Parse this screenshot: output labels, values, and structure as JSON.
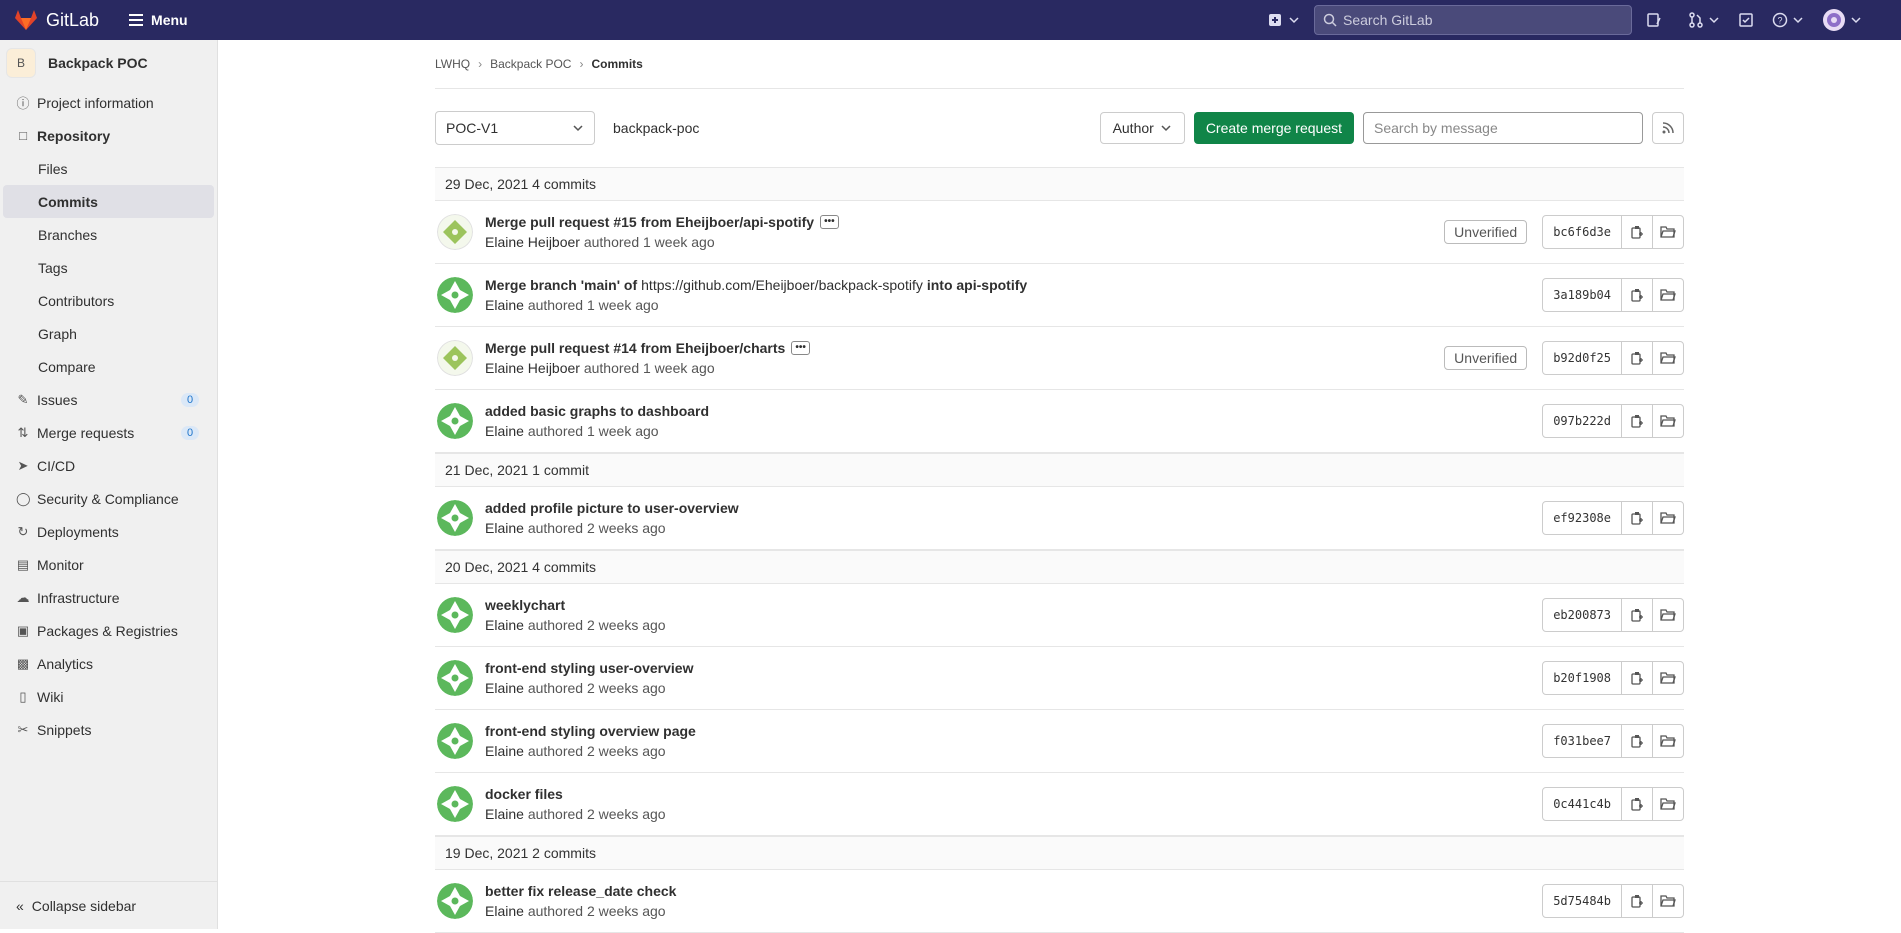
{
  "topbar": {
    "brand": "GitLab",
    "menu": "Menu",
    "search_placeholder": "Search GitLab"
  },
  "sidebar": {
    "project_initial": "B",
    "project_name": "Backpack POC",
    "items": [
      {
        "label": "Project information",
        "icon": "info-icon"
      },
      {
        "label": "Repository",
        "icon": "repository-icon"
      },
      {
        "label": "Files"
      },
      {
        "label": "Commits"
      },
      {
        "label": "Branches"
      },
      {
        "label": "Tags"
      },
      {
        "label": "Contributors"
      },
      {
        "label": "Graph"
      },
      {
        "label": "Compare"
      },
      {
        "label": "Issues",
        "count": "0"
      },
      {
        "label": "Merge requests",
        "count": "0"
      },
      {
        "label": "CI/CD"
      },
      {
        "label": "Security & Compliance"
      },
      {
        "label": "Deployments"
      },
      {
        "label": "Monitor"
      },
      {
        "label": "Infrastructure"
      },
      {
        "label": "Packages & Registries"
      },
      {
        "label": "Analytics"
      },
      {
        "label": "Wiki"
      },
      {
        "label": "Snippets"
      }
    ],
    "collapse": "Collapse sidebar"
  },
  "breadcrumb": [
    "LWHQ",
    "Backpack POC",
    "Commits"
  ],
  "filters": {
    "branch": "POC-V1",
    "repo": "backpack-poc",
    "author": "Author",
    "create_mr": "Create merge request",
    "search_placeholder": "Search by message"
  },
  "groups": [
    {
      "date": "29 Dec, 2021 4 commits",
      "commits": [
        {
          "title": "Merge pull request #15 from Eheijboer/api-spotify",
          "author": "Elaine Heijboer",
          "time": "authored 1 week ago",
          "sha": "bc6f6d3e",
          "unverified": "Unverified"
        },
        {
          "t1": "Merge branch 'main' of",
          "tlink": "https://github.com/Eheijboer/backpack-spotify",
          "t2": "into api-spotify",
          "author": "Elaine",
          "time": "authored 1 week ago",
          "sha": "3a189b04"
        },
        {
          "title": "Merge pull request #14 from Eheijboer/charts",
          "author": "Elaine Heijboer",
          "time": "authored 1 week ago",
          "sha": "b92d0f25",
          "unverified": "Unverified"
        },
        {
          "title": "added basic graphs to dashboard",
          "author": "Elaine",
          "time": "authored 1 week ago",
          "sha": "097b222d"
        }
      ]
    },
    {
      "date": "21 Dec, 2021 1 commit",
      "commits": [
        {
          "title": "added profile picture to user-overview",
          "author": "Elaine",
          "time": "authored 2 weeks ago",
          "sha": "ef92308e"
        }
      ]
    },
    {
      "date": "20 Dec, 2021 4 commits",
      "commits": [
        {
          "title": "weeklychart",
          "author": "Elaine",
          "time": "authored 2 weeks ago",
          "sha": "eb200873"
        },
        {
          "title": "front-end styling user-overview",
          "author": "Elaine",
          "time": "authored 2 weeks ago",
          "sha": "b20f1908"
        },
        {
          "title": "front-end styling overview page",
          "author": "Elaine",
          "time": "authored 2 weeks ago",
          "sha": "f031bee7"
        },
        {
          "title": "docker files",
          "author": "Elaine",
          "time": "authored 2 weeks ago",
          "sha": "0c441c4b"
        }
      ]
    },
    {
      "date": "19 Dec, 2021 2 commits",
      "commits": [
        {
          "title": "better fix release_date check",
          "author": "Elaine",
          "time": "authored 2 weeks ago",
          "sha": "5d75484b"
        }
      ]
    }
  ]
}
